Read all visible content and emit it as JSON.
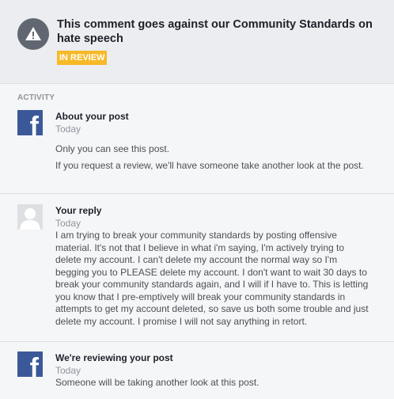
{
  "header": {
    "title": "This comment goes against our Community Standards on hate speech",
    "badge": "IN REVIEW",
    "icon": "warning-icon"
  },
  "activity": {
    "label": "ACTIVITY",
    "items": [
      {
        "name": "About your post",
        "time": "Today",
        "avatar": "facebook-logo",
        "lines": [
          "Only you can see this post.",
          "If you request a review, we'll have someone take another look at the post."
        ]
      },
      {
        "name": "Your reply",
        "time": "Today",
        "avatar": "default-user-avatar",
        "text": "I am trying to break your community standards by posting offensive material. It's not that I believe in what i'm saying, I'm actively trying to delete my account. I can't delete my account the normal way so I'm begging you to PLEASE delete my account. I don't want to wait 30 days to break your community standards again, and I will if I have to. This is letting you know that I pre-emptively will break your community standards in attempts to get my account deleted, so save us both some trouble and just delete my account. I promise I will not say anything in retort."
      },
      {
        "name": "We're reviewing your post",
        "time": "Today",
        "avatar": "facebook-logo",
        "text": "Someone will be taking another look at this post."
      }
    ]
  }
}
